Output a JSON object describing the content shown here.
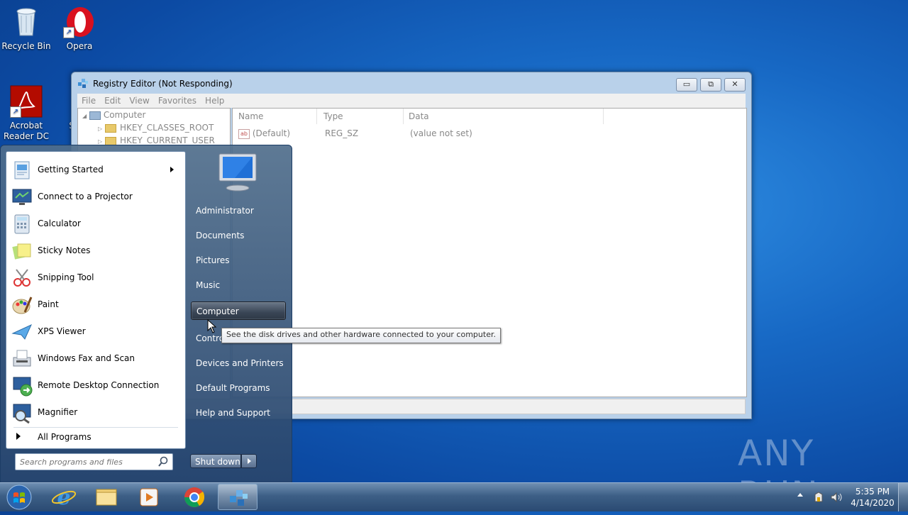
{
  "desktop": {
    "icons": [
      {
        "label": "Recycle Bin"
      },
      {
        "label": "Opera"
      },
      {
        "label": "Acrobat Reader DC"
      },
      {
        "label": "S"
      }
    ]
  },
  "regedit": {
    "title": "Registry Editor (Not Responding)",
    "menu": [
      "File",
      "Edit",
      "View",
      "Favorites",
      "Help"
    ],
    "tree": [
      "Computer",
      "HKEY_CLASSES_ROOT",
      "HKEY_CURRENT_USER"
    ],
    "columns": [
      "Name",
      "Type",
      "Data"
    ],
    "rows": [
      {
        "name": "(Default)",
        "type": "REG_SZ",
        "data": "(value not set)"
      }
    ]
  },
  "start_menu": {
    "programs": [
      {
        "label": "Getting Started",
        "icon": "getting-started-icon"
      },
      {
        "label": "Connect to a Projector",
        "icon": "projector-icon"
      },
      {
        "label": "Calculator",
        "icon": "calculator-icon"
      },
      {
        "label": "Sticky Notes",
        "icon": "sticky-notes-icon"
      },
      {
        "label": "Snipping Tool",
        "icon": "snipping-tool-icon"
      },
      {
        "label": "Paint",
        "icon": "paint-icon"
      },
      {
        "label": "XPS Viewer",
        "icon": "xps-viewer-icon"
      },
      {
        "label": "Windows Fax and Scan",
        "icon": "fax-scan-icon"
      },
      {
        "label": "Remote Desktop Connection",
        "icon": "remote-desktop-icon"
      },
      {
        "label": "Magnifier",
        "icon": "magnifier-icon"
      }
    ],
    "all_programs": "All Programs",
    "search_placeholder": "Search programs and files",
    "right_items": [
      "Administrator",
      "Documents",
      "Pictures",
      "Music",
      "Computer",
      "Control Panel",
      "Devices and Printers",
      "Default Programs",
      "Help and Support"
    ],
    "control_panel_visible": "Contro",
    "shutdown": "Shut down",
    "tooltip": "See the disk drives and other hardware connected to your computer."
  },
  "taskbar": {
    "time": "5:35 PM",
    "date": "4/14/2020"
  },
  "watermark": "ANY RUN"
}
